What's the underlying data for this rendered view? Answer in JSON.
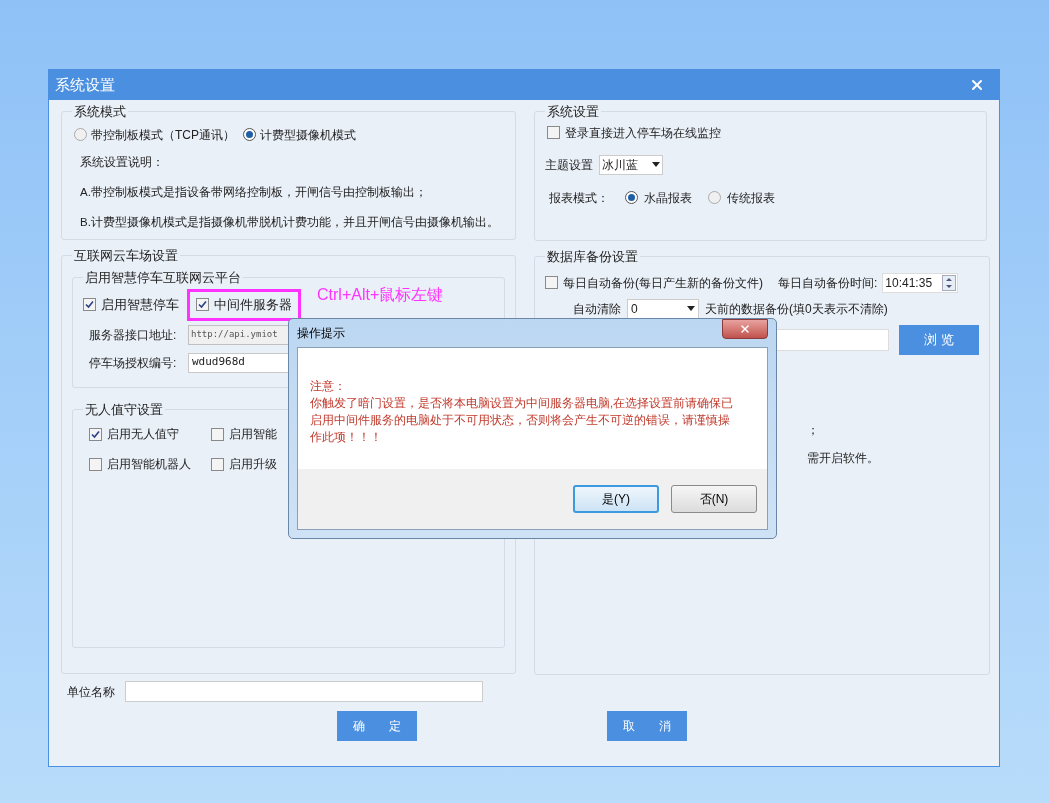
{
  "window": {
    "title": "系统设置"
  },
  "system_mode": {
    "title": "系统模式",
    "options": [
      {
        "label": "带控制板模式（TCP通讯）",
        "selected": false
      },
      {
        "label": "计费型摄像机模式",
        "selected": true
      }
    ],
    "description_title": "系统设置说明：",
    "description_lines": [
      "A.带控制板模式是指设备带网络控制板，开闸信号由控制板输出；",
      "B.计费型摄像机模式是指摄像机带脱机计费功能，并且开闸信号由摄像机输出。"
    ]
  },
  "system_settings": {
    "title": "系统设置",
    "auto_login": {
      "label": "登录直接进入停车场在线监控",
      "checked": false
    },
    "theme": {
      "label": "主题设置",
      "value": "冰川蓝"
    },
    "report_mode": {
      "label": "报表模式：",
      "options": [
        {
          "label": "水晶报表",
          "selected": true
        },
        {
          "label": "传统报表",
          "selected": false
        }
      ]
    }
  },
  "cloud": {
    "title": "互联网云车场设置",
    "platform": {
      "title": "启用智慧停车互联网云平台",
      "checks": [
        {
          "label": "启用智慧停车",
          "checked": true,
          "highlighted": false
        },
        {
          "label": "中间件服务器",
          "checked": true,
          "highlighted": true
        }
      ],
      "annotation": "Ctrl+Alt+鼠标左键",
      "server_label": "服务器接口地址:",
      "server_value": "http://api.ymiot",
      "lot_label": "停车场授权编号:",
      "lot_value": "wdud968d"
    },
    "unattended": {
      "title": "无人值守设置",
      "checks": [
        {
          "label": "启用无人值守",
          "checked": true
        },
        {
          "label": "启用智能",
          "checked": false
        },
        {
          "label": "启用智能机器人",
          "checked": false
        },
        {
          "label": "启用升级",
          "checked": false
        }
      ]
    }
  },
  "backup": {
    "title": "数据库备份设置",
    "daily": {
      "label": "每日自动备份(每日产生新的备份文件)",
      "checked": false
    },
    "time_label": "每日自动备份时间:",
    "time_value": "10:41:35",
    "clean_label": "自动清除",
    "clean_value": "0",
    "clean_suffix": "天前的数据备份(填0天表示不清除)",
    "browse_button": "浏 览",
    "note_lines": [
      "；",
      "需开启软件。"
    ]
  },
  "company": {
    "label": "单位名称"
  },
  "buttons": [
    "确　　定",
    "取　　消"
  ],
  "dialog": {
    "title": "操作提示",
    "heading": "注意：",
    "message": "你触发了暗门设置，是否将本电脑设置为中间服务器电脑,在选择设置前请确保已启用中间件服务的电脑处于不可用状态，否则将会产生不可逆的错误，请谨慎操作此项！！！",
    "buttons": [
      {
        "label": "是(Y)",
        "default": true
      },
      {
        "label": "否(N)",
        "default": false
      }
    ]
  }
}
